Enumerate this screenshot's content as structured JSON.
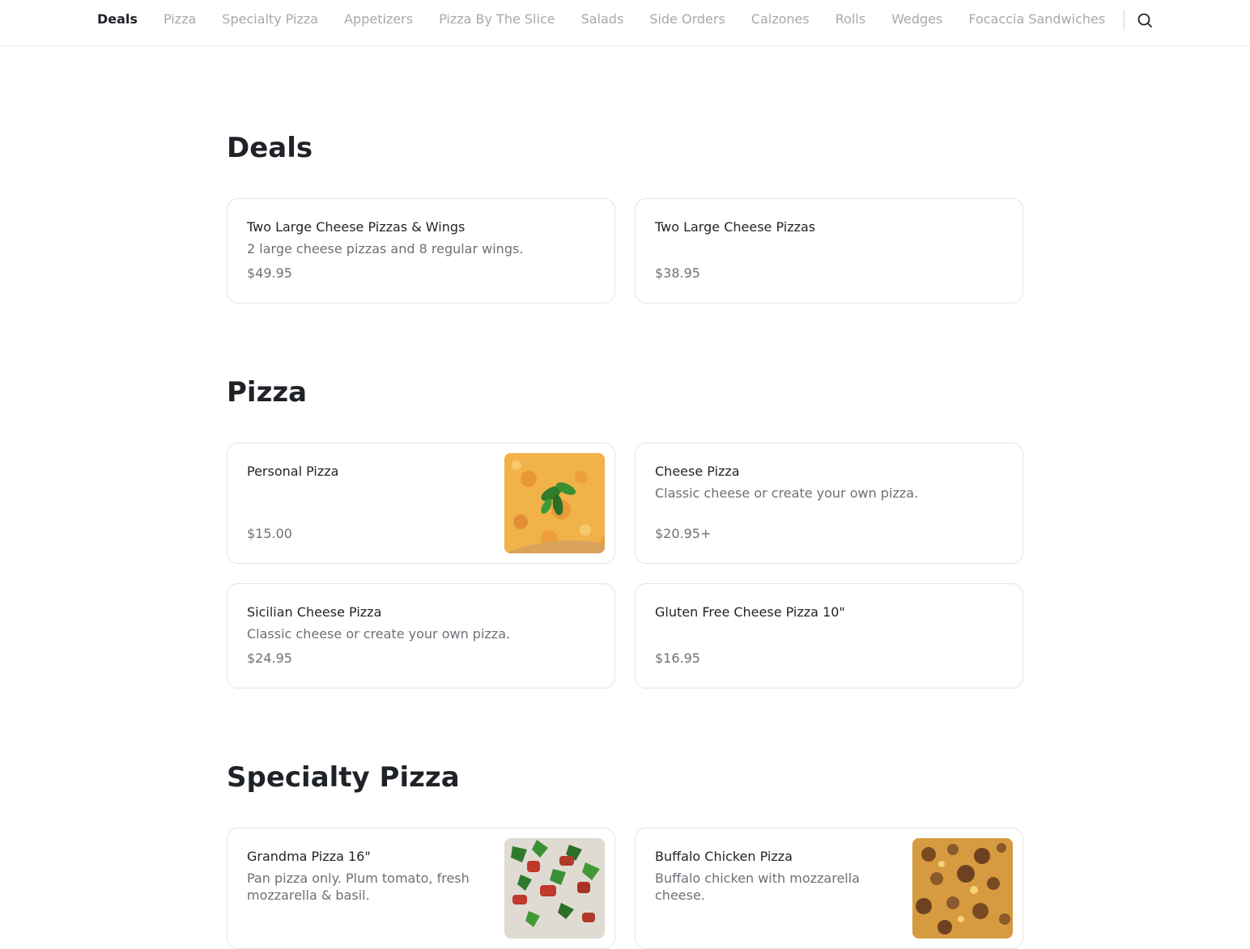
{
  "nav": {
    "items": [
      {
        "label": "Deals",
        "active": true
      },
      {
        "label": "Pizza"
      },
      {
        "label": "Specialty Pizza"
      },
      {
        "label": "Appetizers"
      },
      {
        "label": "Pizza By The Slice"
      },
      {
        "label": "Salads"
      },
      {
        "label": "Side Orders"
      },
      {
        "label": "Calzones"
      },
      {
        "label": "Rolls"
      },
      {
        "label": "Wedges"
      },
      {
        "label": "Focaccia Sandwiches"
      }
    ],
    "search_icon": "search-icon"
  },
  "sections": [
    {
      "title": "Deals",
      "items": [
        {
          "name": "Two Large Cheese Pizzas & Wings",
          "description": "2 large cheese pizzas and 8 regular wings.",
          "price": "$49.95"
        },
        {
          "name": "Two Large Cheese Pizzas",
          "description": "",
          "price": "$38.95"
        }
      ]
    },
    {
      "title": "Pizza",
      "items": [
        {
          "name": "Personal Pizza",
          "description": "",
          "price": "$15.00",
          "image": "cheese-pizza-with-basil-photo"
        },
        {
          "name": "Cheese Pizza",
          "description": "Classic cheese or create your own pizza.",
          "price": "$20.95+"
        },
        {
          "name": "Sicilian Cheese Pizza",
          "description": "Classic cheese or create your own pizza.",
          "price": "$24.95"
        },
        {
          "name": "Gluten Free Cheese Pizza 10\"",
          "description": "",
          "price": "$16.95"
        }
      ]
    },
    {
      "title": "Specialty Pizza",
      "items": [
        {
          "name": "Grandma Pizza 16\"",
          "description": "Pan pizza only. Plum tomato, fresh mozzarella & basil.",
          "image": "grandma-pizza-photo"
        },
        {
          "name": "Buffalo Chicken Pizza",
          "description": "Buffalo chicken with mozzarella cheese.",
          "image": "buffalo-chicken-pizza-photo"
        }
      ]
    }
  ],
  "colors": {
    "active_nav": "#1f2328",
    "inactive_nav": "#a6a9ad",
    "muted_text": "#6b7177",
    "card_border": "#e3e3e3"
  }
}
